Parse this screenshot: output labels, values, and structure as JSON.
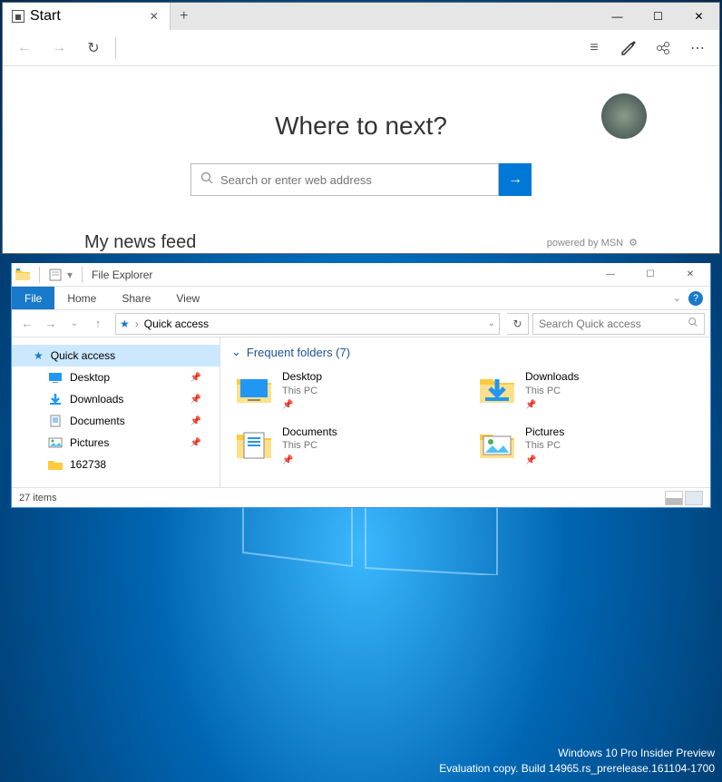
{
  "edge": {
    "tab_title": "Start",
    "heading": "Where to next?",
    "search_placeholder": "Search or enter web address",
    "news_feed": "My news feed",
    "powered": "powered by MSN"
  },
  "file_explorer": {
    "title": "File Explorer",
    "ribbon": {
      "file": "File",
      "home": "Home",
      "share": "Share",
      "view": "View"
    },
    "breadcrumb": "Quick access",
    "search_placeholder": "Search Quick access",
    "sidebar": {
      "items": [
        {
          "label": "Quick access",
          "selected": true
        },
        {
          "label": "Desktop",
          "pinned": true
        },
        {
          "label": "Downloads",
          "pinned": true
        },
        {
          "label": "Documents",
          "pinned": true
        },
        {
          "label": "Pictures",
          "pinned": true
        },
        {
          "label": "162738",
          "pinned": false
        }
      ]
    },
    "section_header": "Frequent folders (7)",
    "folders": [
      {
        "name": "Desktop",
        "location": "This PC"
      },
      {
        "name": "Downloads",
        "location": "This PC"
      },
      {
        "name": "Documents",
        "location": "This PC"
      },
      {
        "name": "Pictures",
        "location": "This PC"
      }
    ],
    "status": "27 items"
  },
  "watermark": {
    "line1": "Windows 10 Pro Insider Preview",
    "line2": "Evaluation copy. Build 14965.rs_prerelease.161104-1700"
  }
}
